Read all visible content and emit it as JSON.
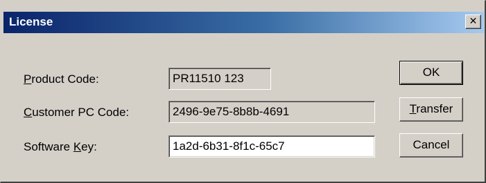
{
  "window": {
    "title": "License",
    "close_glyph": "✕",
    "close_icon": "close-icon"
  },
  "form": {
    "product_code": {
      "label_accel": "P",
      "label_rest": "roduct Code:",
      "value": "PR11510 123"
    },
    "customer_pc_code": {
      "label_accel": "C",
      "label_rest": "ustomer PC Code:",
      "value": "2496-9e75-8b8b-4691"
    },
    "software_key": {
      "label_pre": "Software ",
      "label_accel": "K",
      "label_rest": "ey:",
      "value": "1a2d-6b31-8f1c-65c7"
    }
  },
  "buttons": {
    "ok": "OK",
    "transfer_accel": "T",
    "transfer_rest": "ransfer",
    "cancel": "Cancel"
  }
}
